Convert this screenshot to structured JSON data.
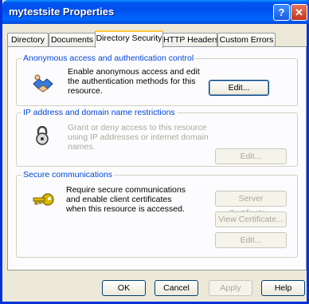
{
  "window": {
    "title": "mytestsite Properties",
    "help_glyph": "?",
    "close_glyph": "✕"
  },
  "tabs": [
    {
      "label": "Directory"
    },
    {
      "label": "Documents"
    },
    {
      "label": "Directory Security"
    },
    {
      "label": "HTTP Headers"
    },
    {
      "label": "Custom Errors"
    }
  ],
  "active_tab": "Directory Security",
  "anonymous": {
    "title": "Anonymous access and authentication control",
    "description": "Enable anonymous access and edit the authentication methods for this resource.",
    "edit_label": "Edit..."
  },
  "ip_restrictions": {
    "title": "IP address and domain name restrictions",
    "description": "Grant or deny access to this resource using IP addresses or internet domain names.",
    "edit_label": "Edit..."
  },
  "secure_comm": {
    "title": "Secure communications",
    "description": "Require secure communications and enable client certificates when this resource is accessed.",
    "server_cert_label": "Server Certificate...",
    "view_cert_label": "View Certificate...",
    "edit_label": "Edit..."
  },
  "footer": {
    "ok_label": "OK",
    "cancel_label": "Cancel",
    "apply_label": "Apply",
    "help_label": "Help"
  },
  "colors": {
    "titlebar_blue": "#0053ee",
    "group_title_blue": "#0046d5",
    "disabled_text": "#aca899",
    "dialog_bg": "#ece9d8"
  },
  "icons": {
    "anonymous": "handshake-icon",
    "ip": "padlock-icon",
    "secure": "key-icon"
  }
}
